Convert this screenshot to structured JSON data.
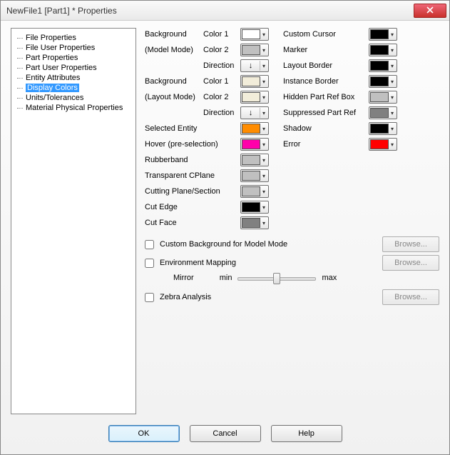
{
  "window": {
    "title": "NewFile1 [Part1] * Properties"
  },
  "tree": {
    "items": [
      {
        "label": "File Properties"
      },
      {
        "label": "File User Properties"
      },
      {
        "label": "Part Properties"
      },
      {
        "label": "Part User Properties"
      },
      {
        "label": "Entity Attributes"
      },
      {
        "label": "Display Colors",
        "selected": true
      },
      {
        "label": "Units/Tolerances"
      },
      {
        "label": "Material Physical Properties"
      }
    ]
  },
  "labels": {
    "bg_model": "Background",
    "bg_model2": "(Model Mode)",
    "bg_layout": "Background",
    "bg_layout2": "(Layout Mode)",
    "color1": "Color 1",
    "color2": "Color 2",
    "direction": "Direction",
    "selected_entity": "Selected Entity",
    "hover": "Hover (pre-selection)",
    "rubberband": "Rubberband",
    "transp_cplane": "Transparent CPlane",
    "cutting_plane": "Cutting Plane/Section",
    "cut_edge": "Cut Edge",
    "cut_face": "Cut Face",
    "custom_cursor": "Custom Cursor",
    "marker": "Marker",
    "layout_border": "Layout Border",
    "instance_border": "Instance Border",
    "hidden_part": "Hidden Part Ref Box",
    "suppressed": "Suppressed Part Ref",
    "shadow": "Shadow",
    "error": "Error",
    "custom_bg": "Custom Background for Model Mode",
    "env_map": "Environment Mapping",
    "mirror": "Mirror",
    "min": "min",
    "max": "max",
    "zebra": "Zebra Analysis",
    "browse": "Browse...",
    "ok": "OK",
    "cancel": "Cancel",
    "help": "Help"
  },
  "colors": {
    "bg_model_c1": "#ffffff",
    "bg_model_c2": "#c0c0c0",
    "bg_layout_c1": "#f2edda",
    "bg_layout_c2": "#f2edda",
    "selected_entity": "#ff8c00",
    "hover": "#ff00aa",
    "rubberband": "#c0c0c0",
    "transp_cplane": "#c0c0c0",
    "cutting_plane": "#c0c0c0",
    "cut_edge": "#000000",
    "cut_face": "#808080",
    "custom_cursor": "#000000",
    "marker": "#000000",
    "layout_border": "#000000",
    "instance_border": "#000000",
    "hidden_part": "#c0c0c0",
    "suppressed": "#808080",
    "shadow": "#000000",
    "error": "#ff0000"
  },
  "slider": {
    "value_pct": 45
  }
}
